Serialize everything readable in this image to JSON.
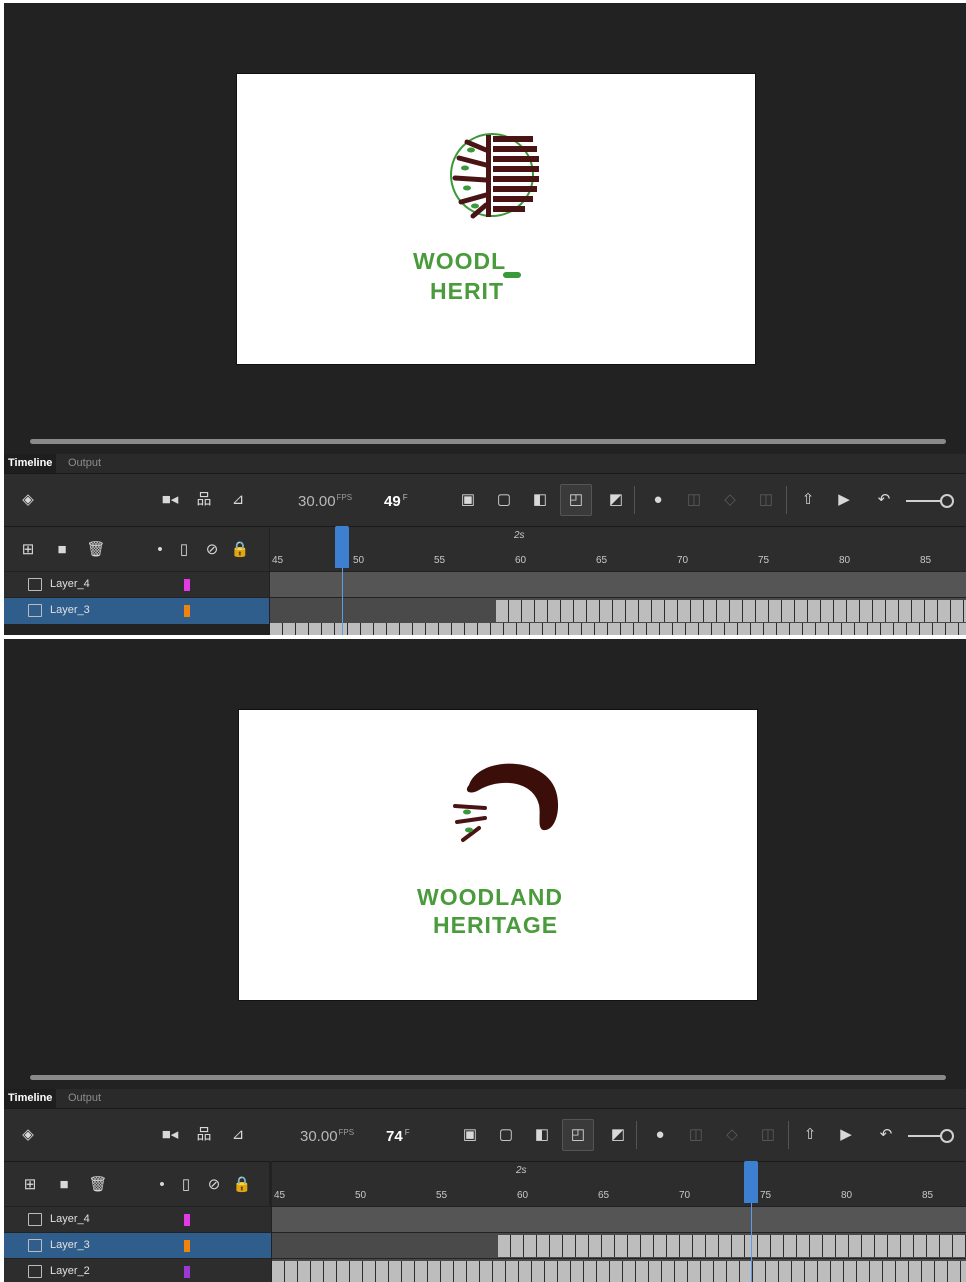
{
  "top": {
    "tabs": [
      {
        "label": "Timeline"
      },
      {
        "label": "Output"
      }
    ],
    "fps": "30.00",
    "fps_unit": "FPS",
    "frame": "49",
    "frame_unit": "F",
    "seconds_marker": "2s",
    "ruler_ticks": [
      "45",
      "50",
      "55",
      "60",
      "65",
      "70",
      "75",
      "80",
      "85"
    ],
    "stage_text": {
      "line1": "WOODL",
      "line2": "HERIT"
    },
    "layers": [
      {
        "name": "Layer_4",
        "color": "#e23be5"
      },
      {
        "name": "Layer_3",
        "color": "#f0820f",
        "selected": true
      }
    ]
  },
  "bottom": {
    "tabs": [
      {
        "label": "Timeline"
      },
      {
        "label": "Output"
      }
    ],
    "fps": "30.00",
    "fps_unit": "FPS",
    "frame": "74",
    "frame_unit": "F",
    "seconds_marker": "2s",
    "ruler_ticks": [
      "45",
      "50",
      "55",
      "60",
      "65",
      "70",
      "75",
      "80",
      "85"
    ],
    "stage_text": {
      "line1": "WOODLAND",
      "line2": "HERITAGE"
    },
    "layers": [
      {
        "name": "Layer_4",
        "color": "#e23be5"
      },
      {
        "name": "Layer_3",
        "color": "#f0820f",
        "selected": true
      },
      {
        "name": "Layer_2",
        "color": "#9a39d6"
      }
    ]
  },
  "colors": {
    "accent_playhead": "#3d7fd1",
    "brand_green": "#4a9b3c",
    "brand_brown": "#4a1010"
  }
}
